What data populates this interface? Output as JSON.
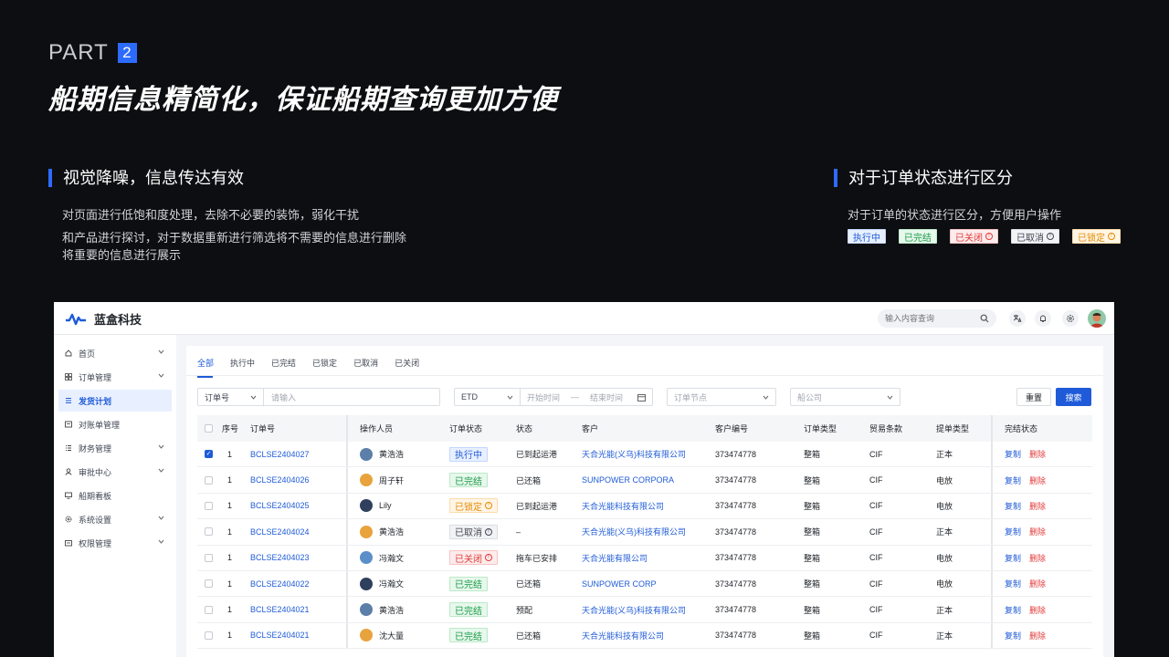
{
  "part": {
    "label": "PART",
    "number": "2"
  },
  "headline": "船期信息精简化，保证船期查询更加方便",
  "section_left": {
    "title": "视觉降噪，信息传达有效",
    "lines": [
      "对页面进行低饱和度处理，去除不必要的装饰，弱化干扰",
      "和产品进行探讨，对于数据重新进行筛选将不需要的信息进行删除",
      "将重要的信息进行展示"
    ]
  },
  "section_right": {
    "title": "对于订单状态进行区分",
    "text": "对于订单的状态进行区分，方便用户操作",
    "tags": [
      "执行中",
      "已完结",
      "已关闭",
      "已取消",
      "已锁定"
    ]
  },
  "app": {
    "brand": "蓝盒科技",
    "search_placeholder": "输入内容查询",
    "sidebar": [
      "首页",
      "订单管理",
      "发货计划",
      "对账单管理",
      "财务管理",
      "审批中心",
      "船期看板",
      "系统设置",
      "权限管理"
    ],
    "tabs": [
      "全部",
      "执行中",
      "已完结",
      "已锁定",
      "已取消",
      "已关闭"
    ],
    "filters": {
      "order_field": "订单号",
      "order_placeholder": "请输入",
      "date_field": "ETD",
      "start_placeholder": "开始时间",
      "date_sep": "—",
      "end_placeholder": "结束时间",
      "node_placeholder": "订单节点",
      "ship_placeholder": "船公司",
      "reset": "重置",
      "search": "搜索"
    },
    "table": {
      "headers": [
        "序号",
        "订单号",
        "操作人员",
        "订单状态",
        "状态",
        "客户",
        "客户编号",
        "订单类型",
        "贸易条款",
        "提单类型",
        "完结状态"
      ],
      "copy_label": "复制",
      "delete_label": "删除",
      "rows": [
        {
          "idx": "1",
          "order": "BCLSE2404027",
          "operator": "黄浩浩",
          "status": "执行中",
          "state": "已到起运港",
          "customer": "天合光能(义乌)科技有限公司",
          "cust_no": "373474778",
          "otype": "整箱",
          "term": "CIF",
          "bl": "正本",
          "checked": true
        },
        {
          "idx": "1",
          "order": "BCLSE2404026",
          "operator": "周子轩",
          "status": "已完结",
          "state": "已还箱",
          "customer": "SUNPOWER CORPORA",
          "cust_no": "373474778",
          "otype": "整箱",
          "term": "CIF",
          "bl": "电放",
          "checked": false
        },
        {
          "idx": "1",
          "order": "BCLSE2404025",
          "operator": "Lily",
          "status": "已锁定",
          "state": "已到起运港",
          "customer": "天合光能科技有限公司",
          "cust_no": "373474778",
          "otype": "整箱",
          "term": "CIF",
          "bl": "电放",
          "checked": false
        },
        {
          "idx": "1",
          "order": "BCLSE2404024",
          "operator": "黄浩浩",
          "status": "已取消",
          "state": "–",
          "customer": "天合光能(义乌)科技有限公司",
          "cust_no": "373474778",
          "otype": "整箱",
          "term": "CIF",
          "bl": "正本",
          "checked": false
        },
        {
          "idx": "1",
          "order": "BCLSE2404023",
          "operator": "冯瀚文",
          "status": "已关闭",
          "state": "拖车已安排",
          "customer": "天合光能有限公司",
          "cust_no": "373474778",
          "otype": "整箱",
          "term": "CIF",
          "bl": "电放",
          "checked": false
        },
        {
          "idx": "1",
          "order": "BCLSE2404022",
          "operator": "冯瀚文",
          "status": "已完结",
          "state": "已还箱",
          "customer": "SUNPOWER CORP",
          "cust_no": "373474778",
          "otype": "整箱",
          "term": "CIF",
          "bl": "电放",
          "checked": false
        },
        {
          "idx": "1",
          "order": "BCLSE2404021",
          "operator": "黄浩浩",
          "status": "已完结",
          "state": "预配",
          "customer": "天合光能(义乌)科技有限公司",
          "cust_no": "373474778",
          "otype": "整箱",
          "term": "CIF",
          "bl": "正本",
          "checked": false
        },
        {
          "idx": "1",
          "order": "BCLSE2404021",
          "operator": "沈大量",
          "status": "已完结",
          "state": "已还箱",
          "customer": "天合光能科技有限公司",
          "cust_no": "373474778",
          "otype": "整箱",
          "term": "CIF",
          "bl": "正本",
          "checked": false
        }
      ]
    }
  },
  "colors": {
    "accent": "#2d6bff",
    "link": "#1f5bd9",
    "danger": "#e23a3a",
    "success": "#1b9b47",
    "warning": "#e58a00"
  }
}
